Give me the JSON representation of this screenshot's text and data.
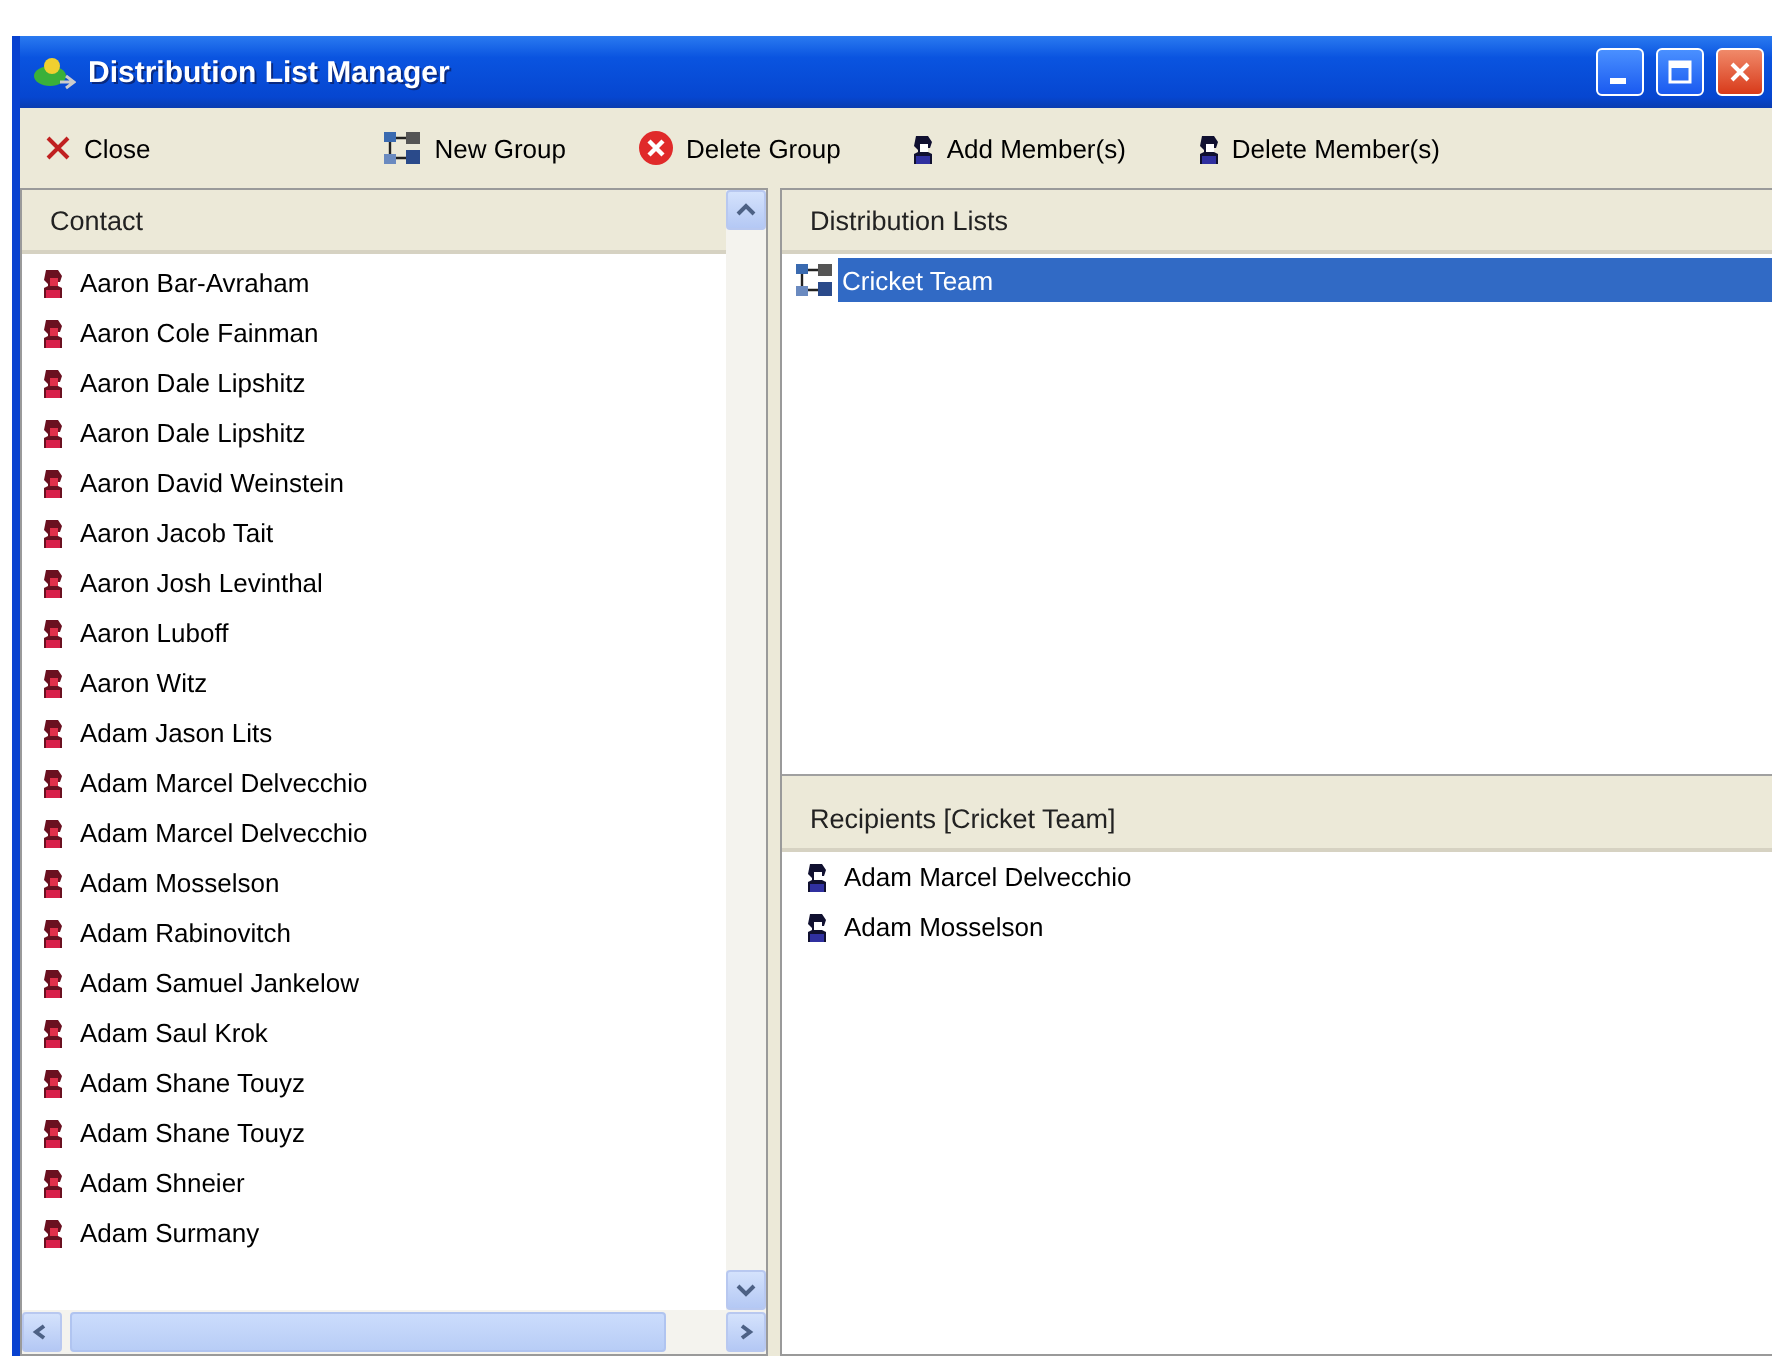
{
  "window": {
    "title": "Distribution List Manager"
  },
  "toolbar": [
    {
      "kind": "close",
      "label": "Close"
    },
    {
      "kind": "new-group",
      "label": "New Group"
    },
    {
      "kind": "delete-group",
      "label": "Delete Group"
    },
    {
      "kind": "add-member",
      "label": "Add Member(s)"
    },
    {
      "kind": "delete-member",
      "label": "Delete Member(s)"
    }
  ],
  "contacts": {
    "header": "Contact",
    "items": [
      "Aaron Bar-Avraham",
      "Aaron Cole Fainman",
      "Aaron Dale Lipshitz",
      "Aaron Dale Lipshitz",
      "Aaron David Weinstein",
      "Aaron Jacob Tait",
      "Aaron Josh Levinthal",
      "Aaron Luboff",
      "Aaron Witz",
      "Adam Jason Lits",
      "Adam Marcel Delvecchio",
      "Adam Marcel Delvecchio",
      "Adam Mosselson",
      "Adam Rabinovitch",
      "Adam Samuel Jankelow",
      "Adam Saul Krok",
      "Adam Shane Touyz",
      "Adam Shane Touyz",
      "Adam Shneier",
      "Adam Surmany"
    ]
  },
  "distribution_lists": {
    "header": "Distribution Lists",
    "items": [
      {
        "name": "Cricket Team",
        "selected": true
      }
    ]
  },
  "recipients": {
    "header": "Recipients [Cricket Team]",
    "items": [
      "Adam Marcel Delvecchio",
      "Adam Mosselson"
    ]
  }
}
